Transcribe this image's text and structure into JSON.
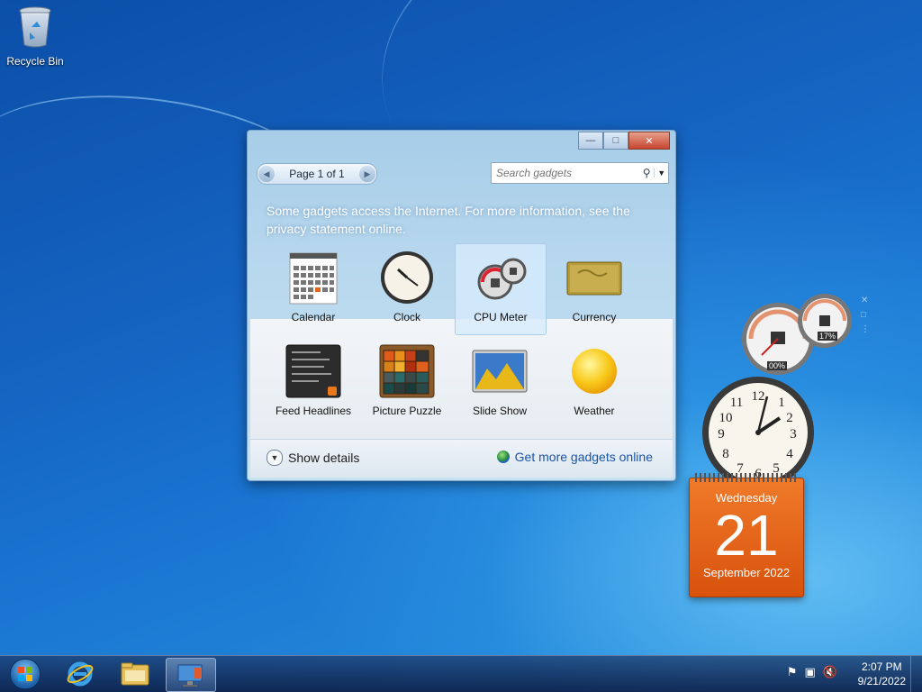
{
  "desktop": {
    "icons": [
      {
        "label": "Recycle Bin",
        "icon": "recycle-bin-icon"
      }
    ]
  },
  "gadget_window": {
    "pager_label": "Page 1 of 1",
    "search_placeholder": "Search gadgets",
    "notice": "Some gadgets access the Internet.  For more information, see the privacy statement online.",
    "gadgets": [
      {
        "name": "Calendar",
        "icon": "calendar-icon"
      },
      {
        "name": "Clock",
        "icon": "clock-icon"
      },
      {
        "name": "CPU Meter",
        "icon": "cpu-meter-icon",
        "selected": true
      },
      {
        "name": "Currency",
        "icon": "currency-icon"
      },
      {
        "name": "Feed Headlines",
        "icon": "feed-headlines-icon"
      },
      {
        "name": "Picture Puzzle",
        "icon": "picture-puzzle-icon"
      },
      {
        "name": "Slide Show",
        "icon": "slide-show-icon"
      },
      {
        "name": "Weather",
        "icon": "weather-icon"
      }
    ],
    "show_details": "Show details",
    "get_more": "Get more gadgets online"
  },
  "desktop_gadgets": {
    "cpu_meter": {
      "cpu_percent": "00%",
      "memory_percent": "17%"
    },
    "calendar": {
      "weekday": "Wednesday",
      "day": "21",
      "month_year": "September 2022"
    }
  },
  "taskbar": {
    "time": "2:07 PM",
    "date": "9/21/2022"
  },
  "colors": {
    "calendar_orange": "#e8631a",
    "link_blue": "#1a55a8",
    "close_red": "#c7462f"
  }
}
